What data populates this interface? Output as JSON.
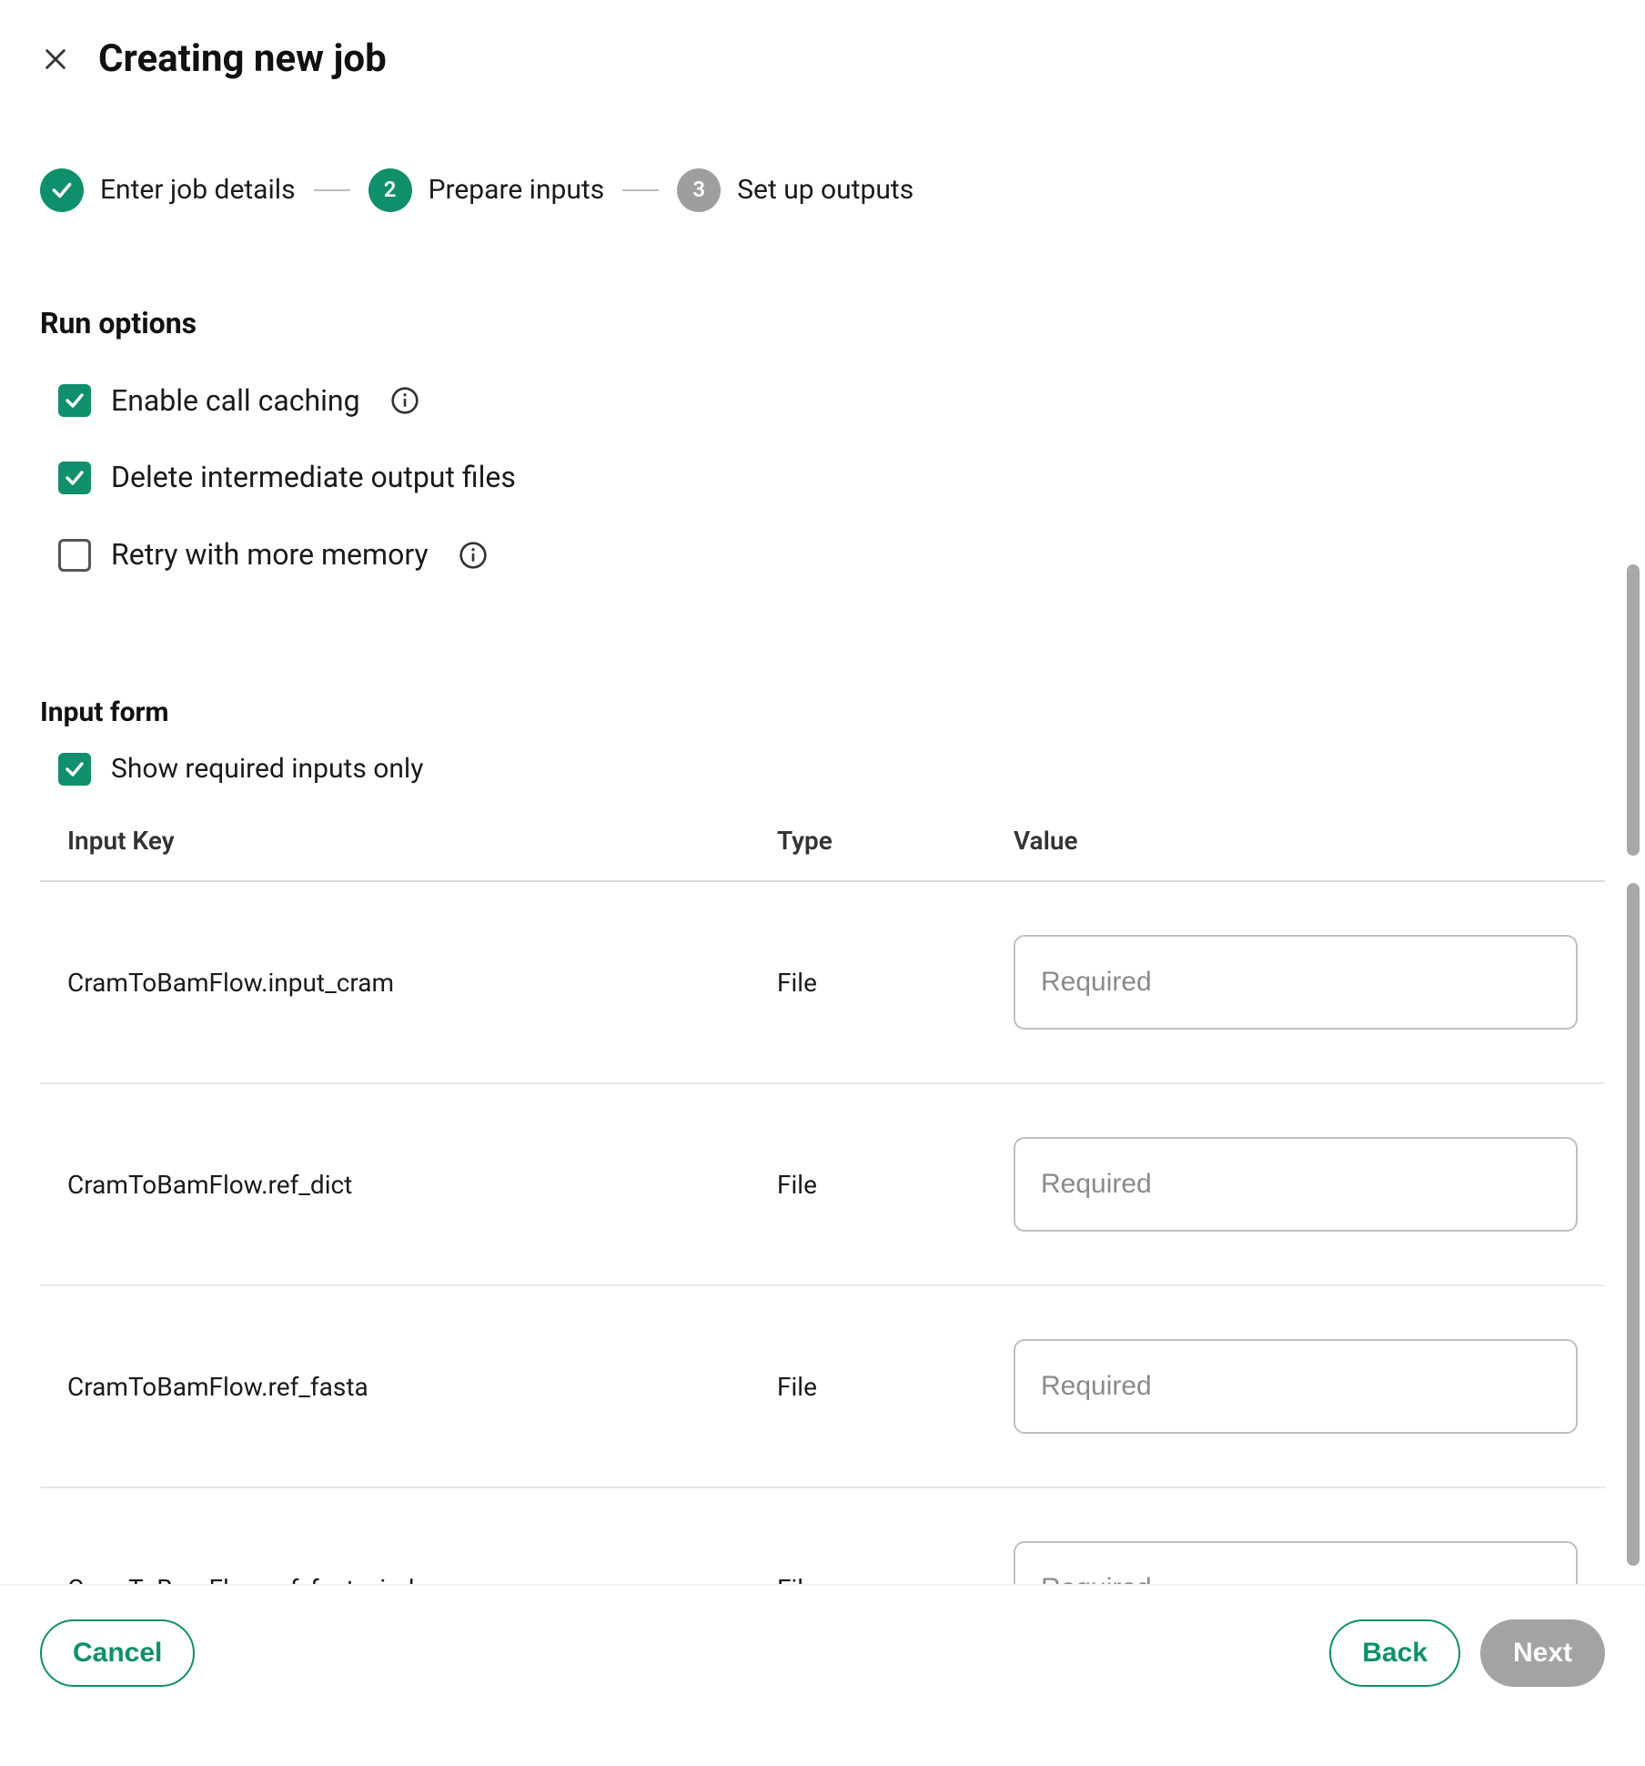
{
  "header": {
    "title": "Creating new job"
  },
  "stepper": {
    "steps": [
      {
        "label": "Enter job details",
        "state": "done"
      },
      {
        "label": "Prepare inputs",
        "state": "active",
        "number": "2"
      },
      {
        "label": "Set up outputs",
        "state": "pending",
        "number": "3"
      }
    ]
  },
  "run_options": {
    "heading": "Run options",
    "items": [
      {
        "label": "Enable call caching",
        "checked": true,
        "info": true
      },
      {
        "label": "Delete intermediate output files",
        "checked": true,
        "info": false
      },
      {
        "label": "Retry with more memory",
        "checked": false,
        "info": true
      }
    ]
  },
  "input_form": {
    "heading": "Input form",
    "show_required_label": "Show required inputs only",
    "show_required_checked": true,
    "columns": {
      "key": "Input Key",
      "type": "Type",
      "value": "Value"
    },
    "rows": [
      {
        "key": "CramToBamFlow.input_cram",
        "type": "File",
        "placeholder": "Required",
        "value": ""
      },
      {
        "key": "CramToBamFlow.ref_dict",
        "type": "File",
        "placeholder": "Required",
        "value": ""
      },
      {
        "key": "CramToBamFlow.ref_fasta",
        "type": "File",
        "placeholder": "Required",
        "value": ""
      },
      {
        "key": "CramToBamFlow.ref_fasta_index",
        "type": "File",
        "placeholder": "Required",
        "value": ""
      }
    ]
  },
  "footer": {
    "cancel": "Cancel",
    "back": "Back",
    "next": "Next"
  },
  "colors": {
    "accent": "#0f8f6b",
    "disabled": "#a3a3a3"
  }
}
